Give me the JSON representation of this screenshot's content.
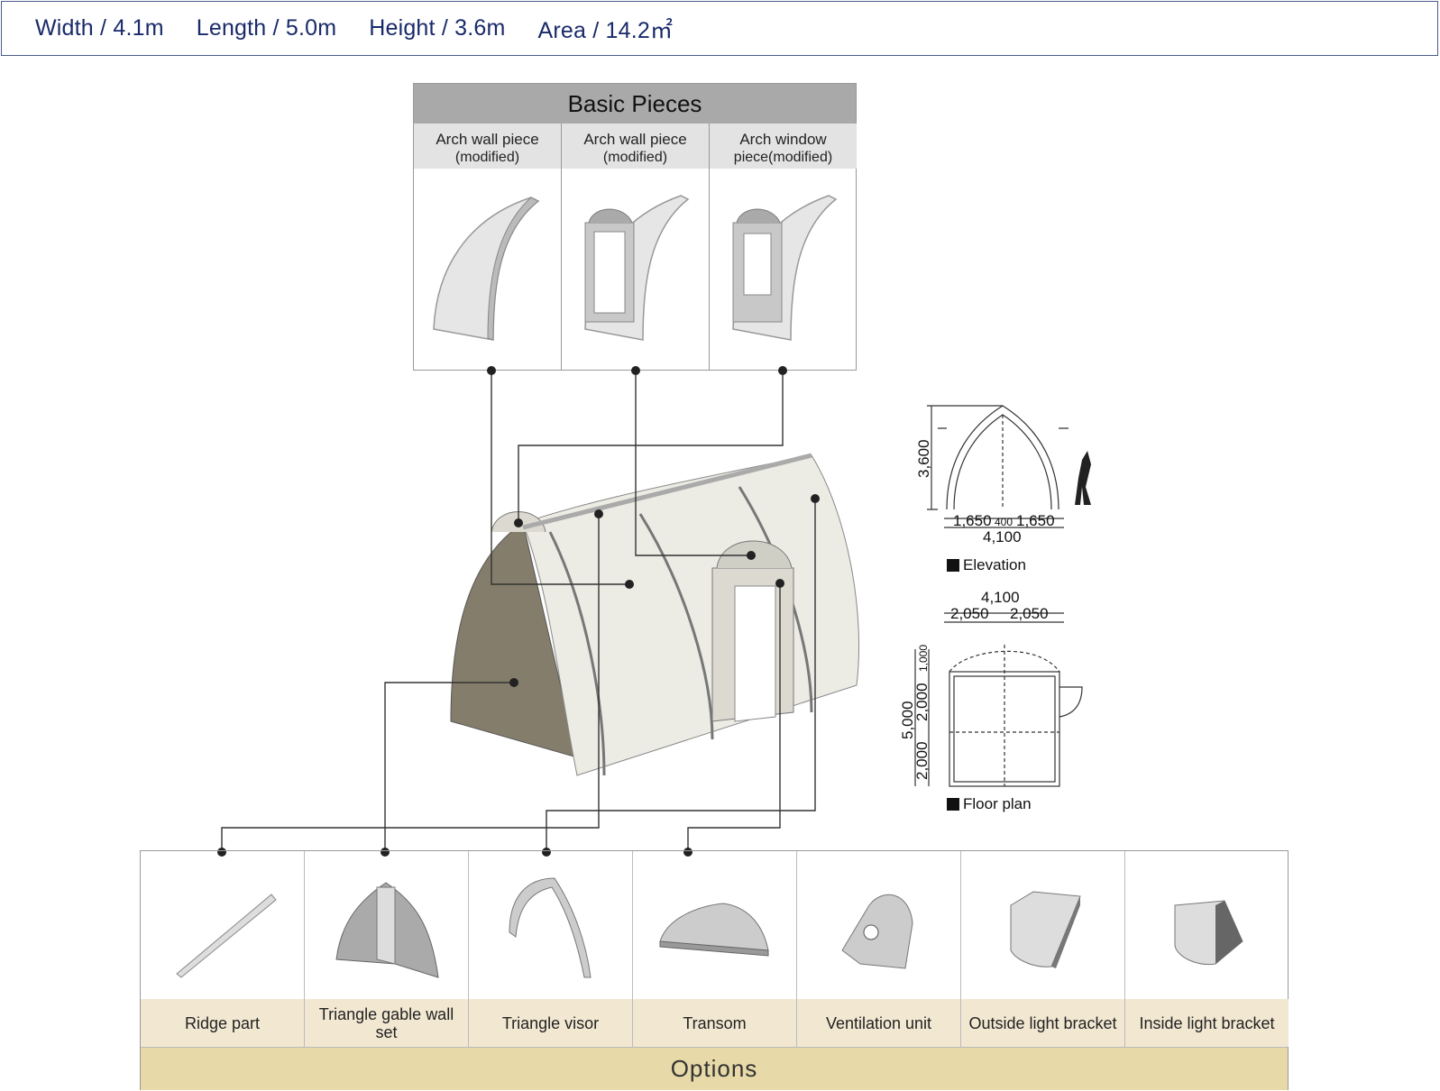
{
  "dimensions": {
    "width": "Width / 4.1m",
    "length": "Length / 5.0m",
    "height": "Height / 3.6m",
    "area": "Area / 14.2㎡"
  },
  "basic_pieces": {
    "title": "Basic Pieces",
    "items": [
      {
        "label": "Arch wall piece",
        "sub": "(modified)"
      },
      {
        "label": "Arch wall piece",
        "sub": "(modified)"
      },
      {
        "label": "Arch window",
        "sub": "piece(modified)"
      }
    ]
  },
  "drawings": {
    "elevation": {
      "label": "Elevation",
      "height": "3,600",
      "widths": [
        "1,650",
        "400",
        "1,650"
      ],
      "total": "4,100"
    },
    "floor_plan": {
      "label": "Floor plan",
      "total_width": "4,100",
      "half_widths": [
        "2,050",
        "2,050"
      ],
      "total_length": "5,000",
      "segments": [
        "1,000",
        "2,000",
        "2,000"
      ]
    }
  },
  "options": {
    "title": "Options",
    "items": [
      {
        "label": "Ridge part"
      },
      {
        "label": "Triangle gable wall set"
      },
      {
        "label": "Triangle visor"
      },
      {
        "label": "Transom"
      },
      {
        "label": "Ventilation unit"
      },
      {
        "label": "Outside light bracket"
      },
      {
        "label": "Inside light bracket"
      }
    ]
  }
}
